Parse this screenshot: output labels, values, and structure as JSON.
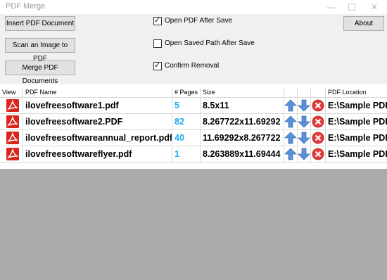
{
  "window": {
    "title": "PDF Merge",
    "minimize": "—",
    "close": "✕"
  },
  "toolbar": {
    "insert_label": "Insert PDF Document",
    "scan_label": "Scan an Image to PDF",
    "merge_label": "Merge PDF Documents",
    "about_label": "About"
  },
  "options": {
    "open_after_save": {
      "label": "Open PDF After Save",
      "checked": true
    },
    "open_saved_path": {
      "label": "Open Saved Path After Save",
      "checked": false
    },
    "confirm_removal": {
      "label": "Confirm Removal",
      "checked": true
    }
  },
  "table": {
    "headers": {
      "view": "View",
      "name": "PDF Name",
      "pages": "# Pages",
      "size": "Size",
      "location": "PDF Location"
    },
    "rows": [
      {
        "name": "ilovefreesoftware1.pdf",
        "pages": "5",
        "size": "8.5x11",
        "location": "E:\\Sample PDF"
      },
      {
        "name": "ilovefreesoftware2.PDF",
        "pages": "82",
        "size": "8.267722x11.69292",
        "location": "E:\\Sample PDF"
      },
      {
        "name": "ilovefreesoftwareannual_report.pdf",
        "pages": "40",
        "size": "11.69292x8.267722",
        "location": "E:\\Sample PDF"
      },
      {
        "name": "ilovefreesoftwareflyer.pdf",
        "pages": "1",
        "size": "8.263889x11.69444",
        "location": "E:\\Sample PDF"
      }
    ]
  },
  "icons": {
    "pdf": "pdf-file-icon",
    "up": "move-up-icon",
    "down": "move-down-icon",
    "remove": "remove-icon"
  },
  "colors": {
    "pdf_red": "#d9261c",
    "arrow_blue": "#5b8fd6",
    "remove_red": "#e03a3a",
    "pages_blue": "#1eaaf1",
    "empty_area": "#ababab"
  }
}
